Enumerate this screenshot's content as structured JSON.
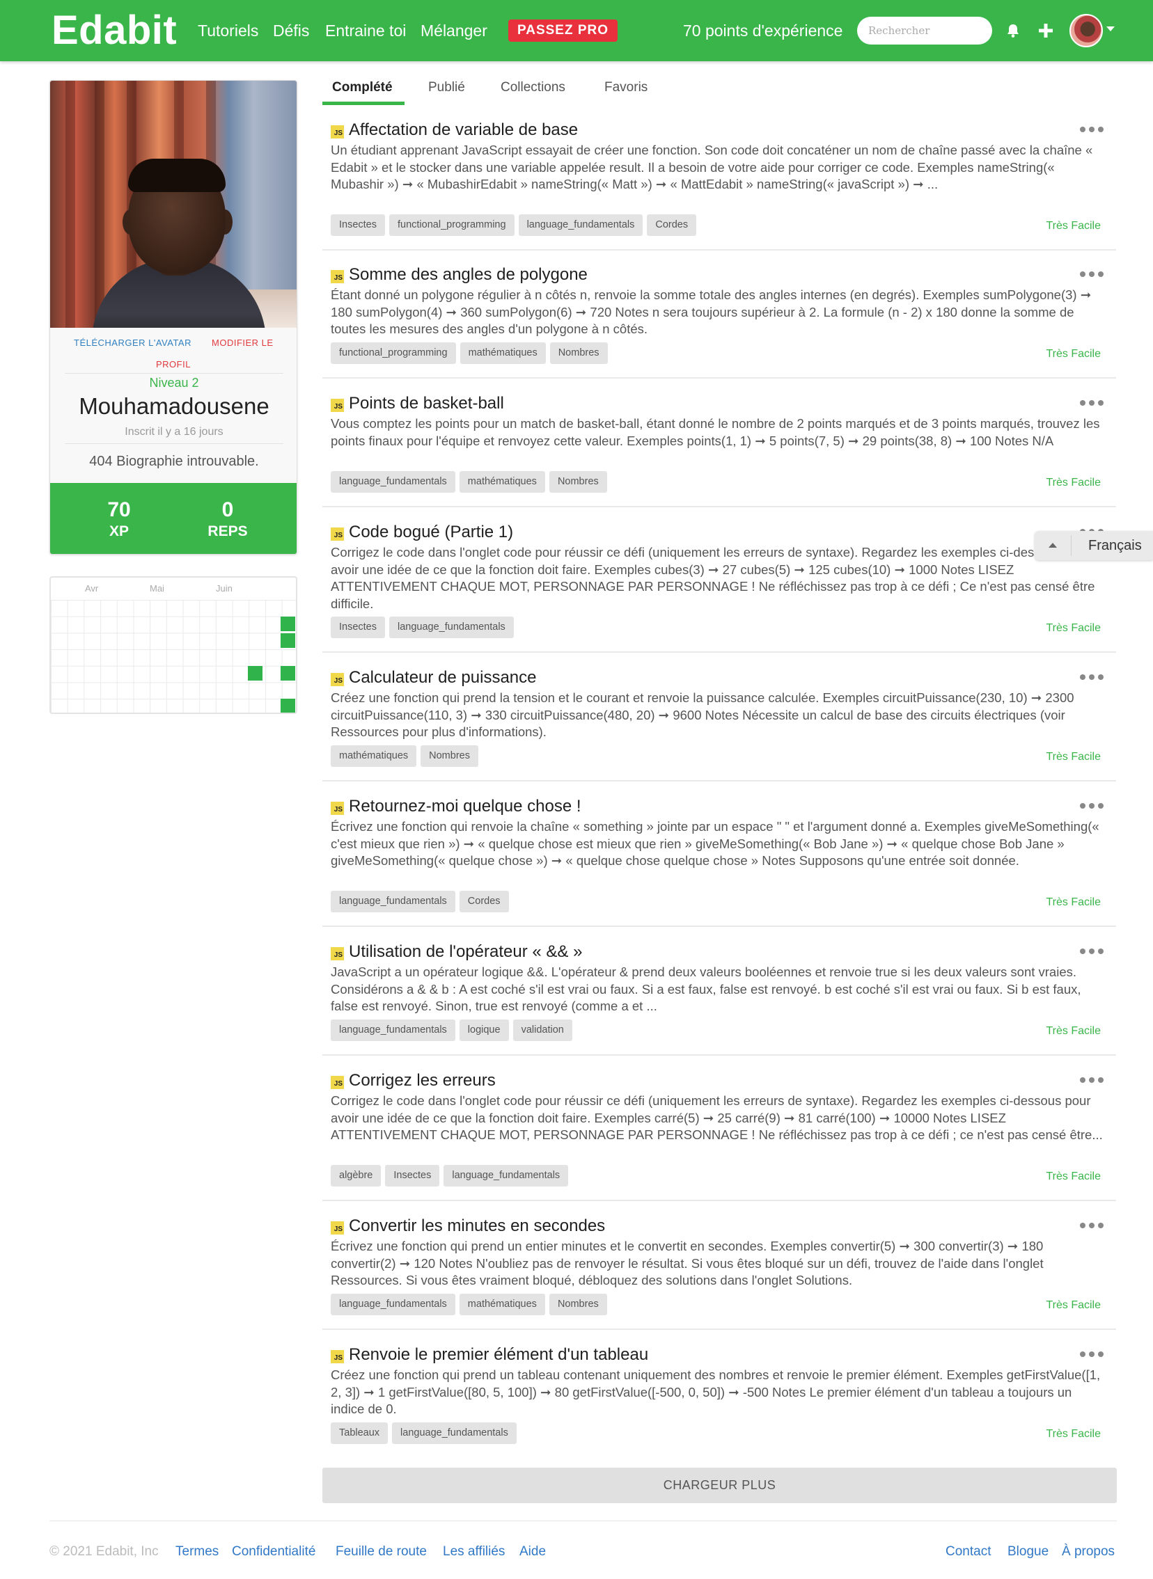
{
  "navbar": {
    "logo": "Edabit",
    "links": [
      "Tutoriels",
      "Défis",
      "Entraine toi",
      "Mélanger"
    ],
    "pro_button": "PASSEZ PRO",
    "xp_text": "70 points d'expérience",
    "search_placeholder": "Rechercher",
    "icons": [
      "bell-icon",
      "plus-icon",
      "avatar",
      "chevron-down-icon"
    ]
  },
  "profile": {
    "upload_avatar": "TÉLÉCHARGER L'AVATAR",
    "edit_profile_part1": "MODIFIER LE",
    "edit_profile_part2": "PROFIL",
    "level": "Niveau 2",
    "username": "Mouhamadousene",
    "joined": "Inscrit il y a 16 jours",
    "bio": "404 Biographie introuvable.",
    "xp_value": "70",
    "xp_label": "XP",
    "reps_value": "0",
    "reps_label": "REPS"
  },
  "heatmap": {
    "months": [
      "Avr",
      "Mai",
      "Juin"
    ]
  },
  "tabs": [
    "Complété",
    "Publié",
    "Collections",
    "Favoris"
  ],
  "active_tab": "Complété",
  "challenges": [
    {
      "badge": "JS",
      "title": "Affectation de variable de base",
      "description": "Un étudiant apprenant JavaScript essayait de créer une fonction. Son code doit concaténer un nom de chaîne passé avec la chaîne « Edabit » et le stocker dans une variable appelée result. Il a besoin de votre aide pour corriger ce code. Exemples nameString(« Mubashir ») ➞ « MubashirEdabit » nameString(« Matt ») ➞ « MattEdabit » nameString(« javaScript ») ➞ ...",
      "tags": [
        "Insectes",
        "functional_programming",
        "language_fundamentals",
        "Cordes"
      ],
      "difficulty": "Très Facile"
    },
    {
      "badge": "JS",
      "title": "Somme des angles de polygone",
      "description": "Étant donné un polygone régulier à n côtés n, renvoie la somme totale des angles internes (en degrés). Exemples sumPolygone(3) ➞ 180 sumPolygon(4) ➞ 360 sumPolygon(6) ➞ 720 Notes n sera toujours supérieur à 2. La formule (n - 2) x 180 donne la somme de toutes les mesures des angles d'un polygone à n côtés.",
      "tags": [
        "functional_programming",
        "mathématiques",
        "Nombres"
      ],
      "difficulty": "Très Facile"
    },
    {
      "badge": "JS",
      "title": "Points de basket-ball",
      "description": "Vous comptez les points pour un match de basket-ball, étant donné le nombre de 2 points marqués et de 3 points marqués, trouvez les points finaux pour l'équipe et renvoyez cette valeur. Exemples points(1, 1) ➞ 5 points(7, 5) ➞ 29 points(38, 8) ➞ 100 Notes N/A",
      "tags": [
        "language_fundamentals",
        "mathématiques",
        "Nombres"
      ],
      "difficulty": "Très Facile"
    },
    {
      "badge": "JS",
      "title": "Code bogué (Partie 1)",
      "description": "Corrigez le code dans l'onglet code pour réussir ce défi (uniquement les erreurs de syntaxe). Regardez les exemples ci-dessous pour avoir une idée de ce que la fonction doit faire. Exemples cubes(3) ➞ 27 cubes(5) ➞ 125 cubes(10) ➞ 1000 Notes LISEZ ATTENTIVEMENT CHAQUE MOT, PERSONNAGE PAR PERSONNAGE ! Ne réfléchissez pas trop à ce défi ; Ce n'est pas censé être difficile.",
      "tags": [
        "Insectes",
        "language_fundamentals"
      ],
      "difficulty": "Très Facile"
    },
    {
      "badge": "JS",
      "title": "Calculateur de puissance",
      "description": "Créez une fonction qui prend la tension et le courant et renvoie la puissance calculée. Exemples circuitPuissance(230, 10) ➞ 2300 circuitPuissance(110, 3) ➞ 330 circuitPuissance(480, 20) ➞ 9600 Notes Nécessite un calcul de base des circuits électriques (voir Ressources pour plus d'informations).",
      "tags": [
        "mathématiques",
        "Nombres"
      ],
      "difficulty": "Très Facile"
    },
    {
      "badge": "JS",
      "title": "Retournez-moi quelque chose !",
      "description": "Écrivez une fonction qui renvoie la chaîne « something » jointe par un espace \" \" et l'argument donné a. Exemples giveMeSomething(« c'est mieux que rien ») ➞ « quelque chose est mieux que rien » giveMeSomething(« Bob Jane ») ➞ « quelque chose Bob Jane » giveMeSomething(« quelque chose ») ➞ « quelque chose quelque chose » Notes Supposons qu'une entrée soit donnée.",
      "tags": [
        "language_fundamentals",
        "Cordes"
      ],
      "difficulty": "Très Facile"
    },
    {
      "badge": "JS",
      "title": "Utilisation de l'opérateur « && »",
      "description": "JavaScript a un opérateur logique &&. L'opérateur & prend deux valeurs booléennes et renvoie true si les deux valeurs sont vraies. Considérons a & & b : A est coché s'il est vrai ou faux. Si a est faux, false est renvoyé. b est coché s'il est vrai ou faux. Si b est faux, false est renvoyé. Sinon, true est renvoyé (comme a et ...",
      "tags": [
        "language_fundamentals",
        "logique",
        "validation"
      ],
      "difficulty": "Très Facile"
    },
    {
      "badge": "JS",
      "title": "Corrigez les erreurs",
      "description": "Corrigez le code dans l'onglet code pour réussir ce défi (uniquement les erreurs de syntaxe). Regardez les exemples ci-dessous pour avoir une idée de ce que la fonction doit faire. Exemples carré(5) ➞ 25 carré(9) ➞ 81 carré(100) ➞ 10000 Notes LISEZ ATTENTIVEMENT CHAQUE MOT, PERSONNAGE PAR PERSONNAGE ! Ne réfléchissez pas trop à ce défi ; ce n'est pas censé être...",
      "tags": [
        "algèbre",
        "Insectes",
        "language_fundamentals"
      ],
      "difficulty": "Très Facile"
    },
    {
      "badge": "JS",
      "title": "Convertir les minutes en secondes",
      "description": "Écrivez une fonction qui prend un entier minutes et le convertit en secondes. Exemples convertir(5) ➞ 300 convertir(3) ➞ 180 convertir(2) ➞ 120 Notes N'oubliez pas de renvoyer le résultat. Si vous êtes bloqué sur un défi, trouvez de l'aide dans l'onglet Ressources. Si vous êtes vraiment bloqué, débloquez des solutions dans l'onglet Solutions.",
      "tags": [
        "language_fundamentals",
        "mathématiques",
        "Nombres"
      ],
      "difficulty": "Très Facile"
    },
    {
      "badge": "JS",
      "title": "Renvoie le premier élément d'un tableau",
      "description": "Créez une fonction qui prend un tableau contenant uniquement des nombres et renvoie le premier élément. Exemples getFirstValue([1, 2, 3]) ➞ 1 getFirstValue([80, 5, 100]) ➞ 80 getFirstValue([-500, 0, 50]) ➞ -500 Notes Le premier élément d'un tableau a toujours un indice de 0.",
      "tags": [
        "Tableaux",
        "language_fundamentals"
      ],
      "difficulty": "Très Facile"
    }
  ],
  "language_popup": {
    "label": "Français",
    "icon": "chevron-up-icon"
  },
  "load_more": "CHARGEUR PLUS",
  "footer": {
    "copyright": "© 2021 Edabit, Inc",
    "left_links": [
      "Termes",
      "Confidentialité",
      "Feuille de route",
      "Les affiliés",
      "Aide"
    ],
    "right_links": [
      "Contact",
      "Blogue",
      "À propos"
    ]
  },
  "colors": {
    "brand_green": "#3ab54a",
    "pro_red": "#e8313c",
    "link_blue": "#3178c6",
    "js_badge_yellow": "#f0d84a"
  }
}
